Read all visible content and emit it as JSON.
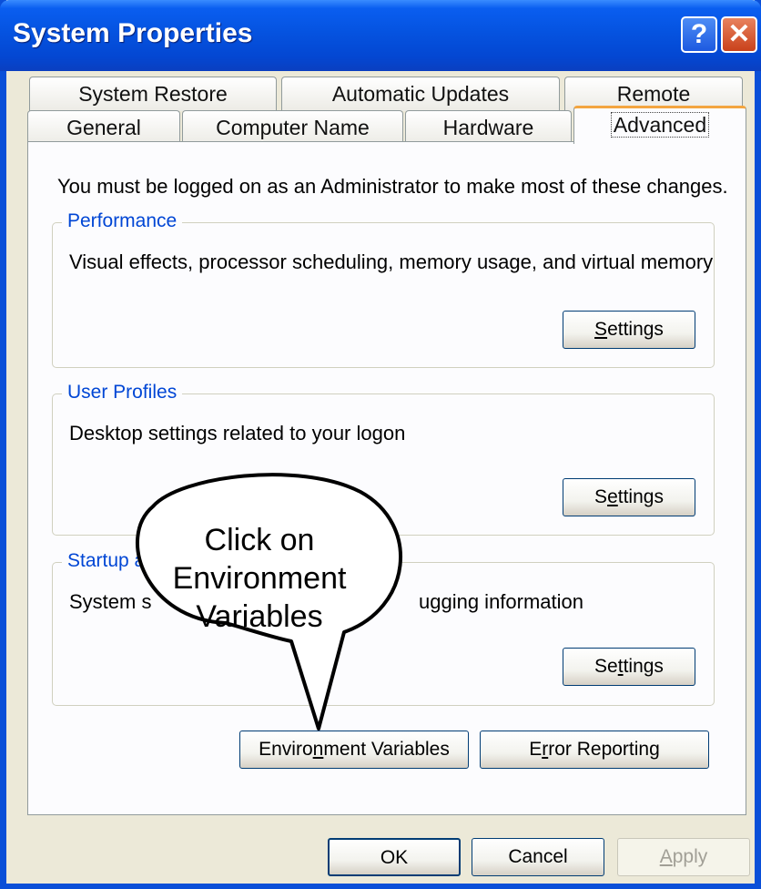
{
  "window": {
    "title": "System Properties"
  },
  "titlebar": {
    "help_glyph": "?",
    "close_glyph": "✕"
  },
  "tabs_row1": [
    "System Restore",
    "Automatic Updates",
    "Remote"
  ],
  "tabs_row2": [
    "General",
    "Computer Name",
    "Hardware",
    "Advanced"
  ],
  "active_tab": "Advanced",
  "notice": "You must be logged on as an Administrator to make most of these changes.",
  "groups": {
    "performance": {
      "title": "Performance",
      "desc": "Visual effects, processor scheduling, memory usage, and virtual memory",
      "button": {
        "mnemonic": "S",
        "rest": "ettings"
      }
    },
    "user_profiles": {
      "title": "User Profiles",
      "desc": "Desktop settings related to your logon",
      "button": {
        "pre": "S",
        "mnemonic": "e",
        "rest": "ttings"
      }
    },
    "startup": {
      "title_visible": "Startup a",
      "desc_left": "System s",
      "desc_right": "ugging information",
      "button": {
        "pre": "Se",
        "mnemonic": "t",
        "rest": "tings"
      }
    }
  },
  "buttons": {
    "env_vars": {
      "pre": "Enviro",
      "mnemonic": "n",
      "rest": "ment Variables"
    },
    "error_reporting": {
      "pre": "E",
      "mnemonic": "r",
      "rest": "ror Reporting"
    },
    "ok": "OK",
    "cancel": "Cancel",
    "apply": {
      "mnemonic": "A",
      "rest": "pply",
      "disabled": true
    }
  },
  "callout": {
    "lines": [
      "Click on",
      "Environment",
      "Variables"
    ]
  },
  "colors": {
    "titlebar": "#0553e0",
    "face": "#ece9d8",
    "group_title": "#0046d5",
    "tab_highlight": "#f3a540"
  }
}
